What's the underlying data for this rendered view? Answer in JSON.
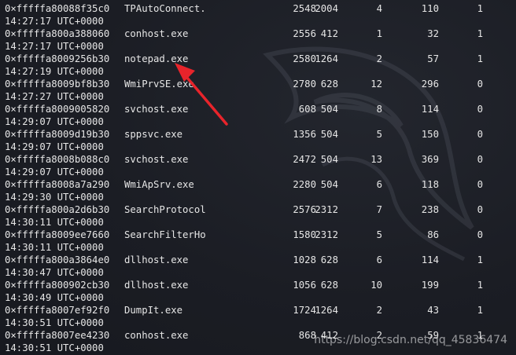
{
  "rows": [
    {
      "offset": "0×fffffa80088f35c0",
      "name": "TPAutoConnect.",
      "pid": "2548",
      "ppid": "2004",
      "threads": "4",
      "handles": "110",
      "session": "1",
      "time": "14:27:17 UTC+0000"
    },
    {
      "offset": "0×fffffa800a388060",
      "name": "conhost.exe",
      "pid": "2556",
      "ppid": "412",
      "threads": "1",
      "handles": "32",
      "session": "1",
      "time": "14:27:17 UTC+0000"
    },
    {
      "offset": "0×fffffa8009256b30",
      "name": "notepad.exe",
      "pid": "2580",
      "ppid": "1264",
      "threads": "2",
      "handles": "57",
      "session": "1",
      "time": "14:27:19 UTC+0000"
    },
    {
      "offset": "0×fffffa8009bf8b30",
      "name": "WmiPrvSE.exe",
      "pid": "2780",
      "ppid": "628",
      "threads": "12",
      "handles": "296",
      "session": "0",
      "time": "14:27:27 UTC+0000"
    },
    {
      "offset": "0×fffffa8009005820",
      "name": "svchost.exe",
      "pid": "608",
      "ppid": "504",
      "threads": "8",
      "handles": "114",
      "session": "0",
      "time": "14:29:07 UTC+0000"
    },
    {
      "offset": "0×fffffa8009d19b30",
      "name": "sppsvc.exe",
      "pid": "1356",
      "ppid": "504",
      "threads": "5",
      "handles": "150",
      "session": "0",
      "time": "14:29:07 UTC+0000"
    },
    {
      "offset": "0×fffffa8008b088c0",
      "name": "svchost.exe",
      "pid": "2472",
      "ppid": "504",
      "threads": "13",
      "handles": "369",
      "session": "0",
      "time": "14:29:07 UTC+0000"
    },
    {
      "offset": "0×fffffa8008a7a290",
      "name": "WmiApSrv.exe",
      "pid": "2280",
      "ppid": "504",
      "threads": "6",
      "handles": "118",
      "session": "0",
      "time": "14:29:30 UTC+0000"
    },
    {
      "offset": "0×fffffa800a2d6b30",
      "name": "SearchProtocol",
      "pid": "2576",
      "ppid": "2312",
      "threads": "7",
      "handles": "238",
      "session": "0",
      "time": "14:30:11 UTC+0000"
    },
    {
      "offset": "0×fffffa8009ee7660",
      "name": "SearchFilterHo",
      "pid": "1580",
      "ppid": "2312",
      "threads": "5",
      "handles": "86",
      "session": "0",
      "time": "14:30:11 UTC+0000"
    },
    {
      "offset": "0×fffffa800a3864e0",
      "name": "dllhost.exe",
      "pid": "1028",
      "ppid": "628",
      "threads": "6",
      "handles": "114",
      "session": "1",
      "time": "14:30:47 UTC+0000"
    },
    {
      "offset": "0×fffffa800902cb30",
      "name": "dllhost.exe",
      "pid": "1056",
      "ppid": "628",
      "threads": "10",
      "handles": "199",
      "session": "1",
      "time": "14:30:49 UTC+0000"
    },
    {
      "offset": "0×fffffa8007ef92f0",
      "name": "DumpIt.exe",
      "pid": "1724",
      "ppid": "1264",
      "threads": "2",
      "handles": "43",
      "session": "1",
      "time": "14:30:51 UTC+0000"
    },
    {
      "offset": "0×fffffa8007ee4230",
      "name": "conhost.exe",
      "pid": "868",
      "ppid": "412",
      "threads": "2",
      "handles": "59",
      "session": "1",
      "time": "14:30:51 UTC+0000"
    }
  ],
  "watermark": "https://blog.csdn.net/qq_45836474",
  "colors": {
    "background": "#1b1d24",
    "text": "#e6e6e6",
    "arrow": "#e8242b"
  }
}
